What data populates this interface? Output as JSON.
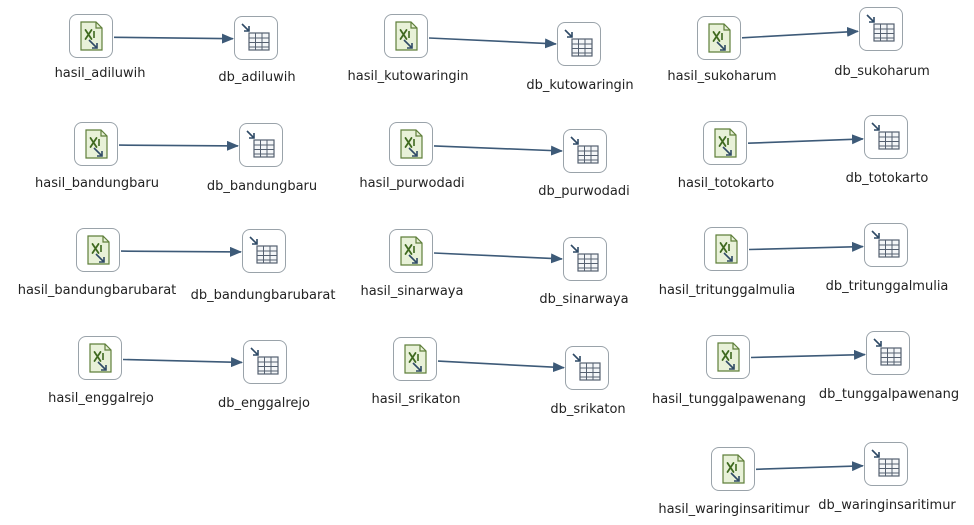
{
  "colors": {
    "hop_line": "#3d5a78",
    "box_border": "#9aa3aa",
    "excel_icon_fill": "#e8f1d8",
    "excel_icon_stroke": "#5f7f3a",
    "table_icon_stroke": "#556070",
    "table_icon_fill": "#f4f6f8",
    "label_text": "#222222"
  },
  "icons": {
    "input": "excel-input-icon",
    "output": "table-output-icon"
  },
  "hops": [
    {
      "from": {
        "label": "hasil_adiluwih"
      },
      "to": {
        "label": "db_adiluwih"
      }
    },
    {
      "from": {
        "label": "hasil_bandungbaru"
      },
      "to": {
        "label": "db_bandungbaru"
      }
    },
    {
      "from": {
        "label": "hasil_bandungbarubarat"
      },
      "to": {
        "label": "db_bandungbarubarat"
      }
    },
    {
      "from": {
        "label": "hasil_enggalrejo"
      },
      "to": {
        "label": "db_enggalrejo"
      }
    },
    {
      "from": {
        "label": "hasil_kutowaringin"
      },
      "to": {
        "label": "db_kutowaringin"
      }
    },
    {
      "from": {
        "label": "hasil_purwodadi"
      },
      "to": {
        "label": "db_purwodadi"
      }
    },
    {
      "from": {
        "label": "hasil_sinarwaya"
      },
      "to": {
        "label": "db_sinarwaya"
      }
    },
    {
      "from": {
        "label": "hasil_srikaton"
      },
      "to": {
        "label": "db_srikaton"
      }
    },
    {
      "from": {
        "label": "hasil_sukoharum"
      },
      "to": {
        "label": "db_sukoharum"
      }
    },
    {
      "from": {
        "label": "hasil_totokarto"
      },
      "to": {
        "label": "db_totokarto"
      }
    },
    {
      "from": {
        "label": "hasil_tritunggalmulia"
      },
      "to": {
        "label": "db_tritunggalmulia"
      }
    },
    {
      "from": {
        "label": "hasil_tunggalpawenang"
      },
      "to": {
        "label": "db_tunggalpawenang"
      }
    },
    {
      "from": {
        "label": "hasil_waringinsaritimur"
      },
      "to": {
        "label": "db_waringinsaritimur"
      }
    }
  ]
}
